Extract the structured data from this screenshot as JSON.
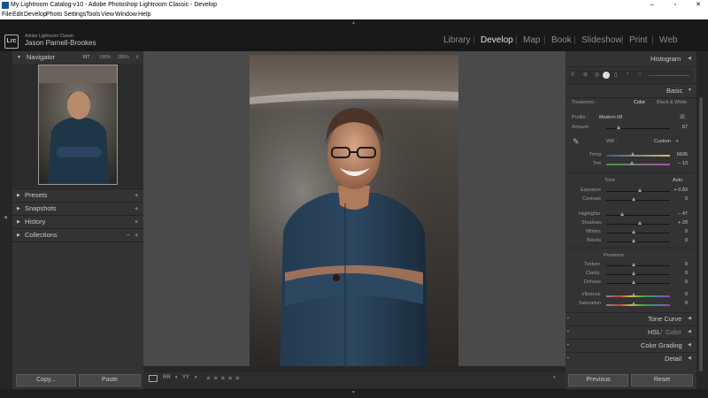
{
  "window": {
    "title": "My Lightroom Catalog-v10 - Adobe Photoshop Lightroom Classic - Develop",
    "minimize": "–",
    "maximize": "▫",
    "close": "✕"
  },
  "menu": [
    "File",
    "Edit",
    "Develop",
    "Photo",
    "Settings",
    "Tools",
    "View",
    "Window",
    "Help"
  ],
  "brand": {
    "logo": "Lrc",
    "subtitle": "Adobe Lightroom Classic",
    "user": "Jason Parnell-Brookes"
  },
  "modules": {
    "library": "Library",
    "develop": "Develop",
    "map": "Map",
    "book": "Book",
    "slideshow": "Slideshow",
    "print": "Print",
    "web": "Web",
    "sep": "|"
  },
  "navigator": {
    "title": "Navigator",
    "fit": "FIT",
    "z100": "100%",
    "z200": "200%",
    "more": "⇕"
  },
  "left_panels": {
    "presets": "Presets",
    "snapshots": "Snapshots",
    "history": "History",
    "collections": "Collections",
    "plus": "+",
    "x": "×",
    "minus": "−"
  },
  "left_buttons": {
    "copy": "Copy...",
    "paste": "Paste"
  },
  "toolbar": {
    "rating": "★★★★★",
    "view1": "▭",
    "view2": "RR",
    "view3": "YY"
  },
  "right_panel": {
    "histogram": "Histogram",
    "basic": "Basic",
    "treatment_label": "Treatment :",
    "treatment_color": "Color",
    "treatment_bw": "Black & White",
    "profile_label": "Profile :",
    "profile_value": "Modern 08",
    "amount_label": "Amount",
    "amount_value": "67",
    "wb_label": "WB :",
    "wb_value": "Custom",
    "temp_label": "Temp",
    "temp_value": "6605",
    "tint_label": "Tint",
    "tint_value": "– 13",
    "tone_label": "Tone",
    "auto_label": "Auto",
    "exposure_label": "Exposure",
    "exposure_value": "+ 0.83",
    "contrast_label": "Contrast",
    "contrast_value": "0",
    "highlights_label": "Highlights",
    "highlights_value": "– 47",
    "shadows_label": "Shadows",
    "shadows_value": "+ 20",
    "whites_label": "Whites",
    "whites_value": "0",
    "blacks_label": "Blacks",
    "blacks_value": "0",
    "presence_label": "Presence",
    "texture_label": "Texture",
    "texture_value": "0",
    "clarity_label": "Clarity",
    "clarity_value": "0",
    "dehaze_label": "Dehaze",
    "dehaze_value": "0",
    "vibrance_label": "Vibrance",
    "vibrance_value": "0",
    "saturation_label": "Saturation",
    "saturation_value": "0",
    "tone_curve": "Tone Curve",
    "hsl": "HSL",
    "hsl_sep": " / ",
    "color": "Color",
    "color_grading": "Color Grading",
    "detail": "Detail",
    "previous": "Previous",
    "reset": "Reset"
  },
  "colors": {
    "panel_bg": "#333333",
    "header_bg": "#191919",
    "center_bg": "#4a4a4a",
    "text": "#c8c8c8",
    "muted": "#9a9a9a"
  }
}
